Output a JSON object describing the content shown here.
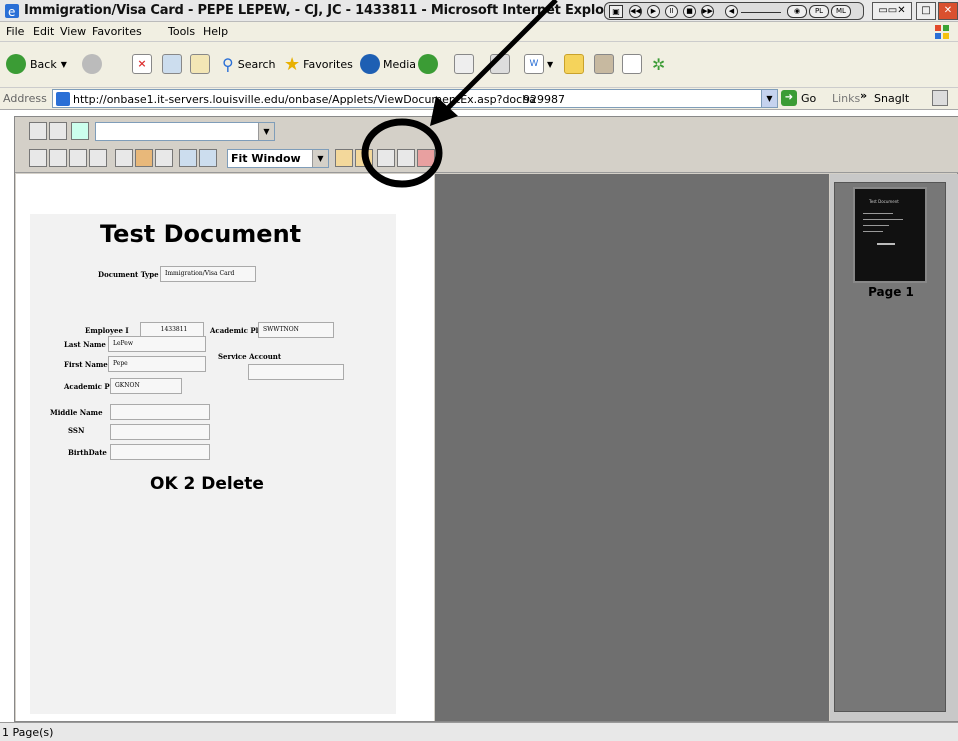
{
  "window": {
    "title": "Immigration/Visa Card - PEPE LEPEW, - CJ, JC - 1433811 - Microsoft Internet Explorer"
  },
  "menu": [
    "File",
    "Edit",
    "View",
    "Favorites",
    "Tools",
    "Help"
  ],
  "toolbar": {
    "back": "Back",
    "search": "Search",
    "favorites": "Favorites",
    "media": "Media"
  },
  "address": {
    "label": "Address",
    "url": "http://onbase1.it-servers.louisville.edu/onbase/Applets/ViewDocumentEx.asp?docha",
    "url_tail": "929987",
    "go": "Go",
    "links": "Links",
    "snagit": "SnagIt"
  },
  "viewer": {
    "zoom": "Fit Window",
    "thumb_title": "Test Document",
    "thumb_label": "Page 1"
  },
  "document": {
    "title": "Test Document",
    "doc_type_label": "Document Type",
    "doc_type_value": "Immigration/Visa Card",
    "employee_label": "Employee I",
    "employee_value": "1433811",
    "academic_plan_label": "Academic Plan",
    "academic_plan_value": "SWWTNON",
    "last_name_label": "Last Name",
    "last_name_value": "LePew",
    "service_account_label": "Service Account",
    "first_name_label": "First Name",
    "first_name_value": "Pepe",
    "academic_p_label": "Academic P",
    "academic_p_value": "GKNON",
    "middle_name_label": "Middle Name",
    "ssn_label": "SSN",
    "birthdate_label": "BirthDate",
    "footer": "OK 2 Delete"
  },
  "status": {
    "pages": "1 Page(s)"
  }
}
